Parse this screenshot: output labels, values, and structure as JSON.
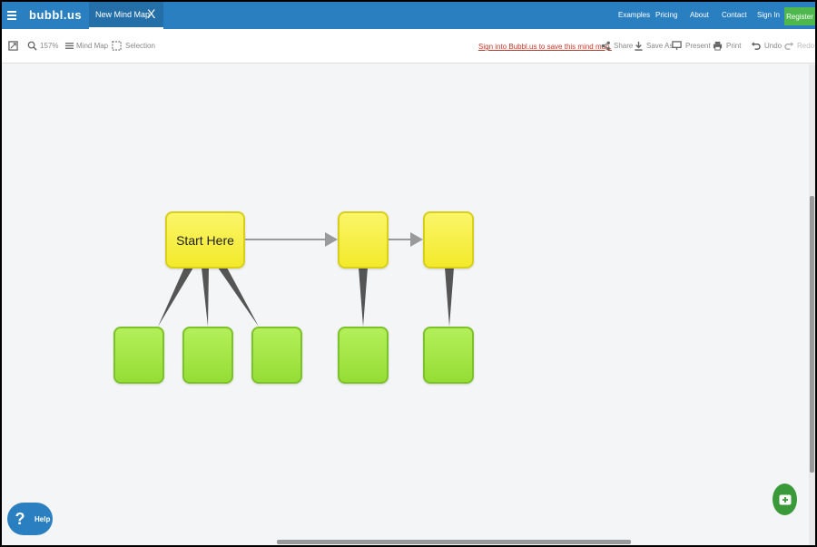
{
  "header": {
    "logo": "bubbl.us",
    "tab": {
      "label": "New Mind Map",
      "close": "X"
    },
    "nav": [
      "Examples",
      "Pricing",
      "About",
      "Contact",
      "Sign In"
    ],
    "register": "Register"
  },
  "toolbar": {
    "zoom": "157%",
    "view": "Mind Map",
    "selection": "Selection",
    "signin_link": "Sign into Bubbl.us to save this mind map.",
    "share": "Share",
    "save_as": "Save As",
    "present": "Present",
    "print": "Print",
    "undo": "Undo",
    "redo": "Redo"
  },
  "mindmap": {
    "root_label": "Start Here"
  },
  "help": {
    "label": "Help",
    "icon": "?"
  },
  "colors": {
    "header": "#2a7fc1",
    "register": "#4eb84e",
    "node_yellow": "#f7f03c",
    "node_green": "#a8e84a",
    "add_button": "#3a9a3a"
  }
}
